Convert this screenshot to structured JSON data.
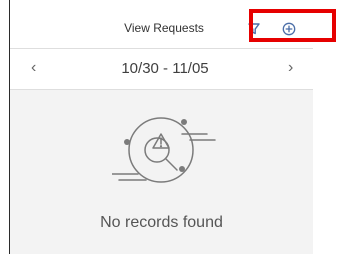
{
  "header": {
    "title": "View Requests",
    "icons": {
      "filter": "filter-icon",
      "add": "add-circle-icon"
    }
  },
  "date_nav": {
    "range": "10/30 - 11/05",
    "prev_label": "‹",
    "next_label": "›"
  },
  "empty_state": {
    "message": "No records found",
    "illustration": "search-warning-illustration"
  },
  "colors": {
    "highlight": "#e60000",
    "icon_blue": "#4b6ea8",
    "content_bg": "#f3f3f3",
    "illustration_stroke": "#7b7b7b"
  }
}
